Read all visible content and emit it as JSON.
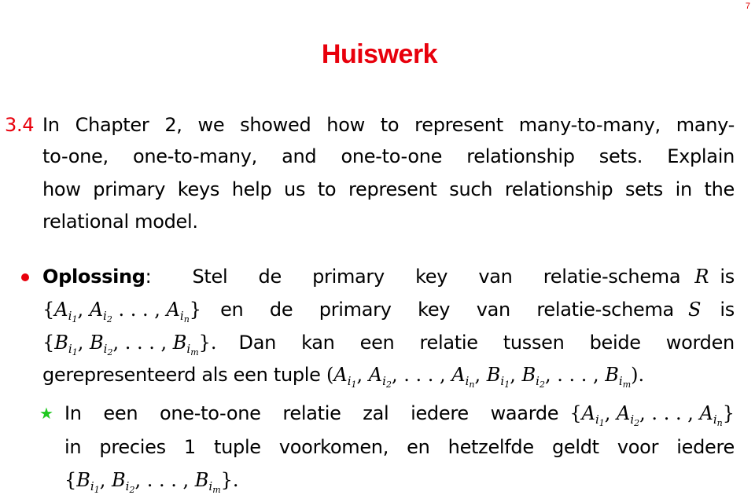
{
  "page_number": "7",
  "title": "Huiswerk",
  "exercise": {
    "number": "3.4",
    "lines": [
      "In Chapter 2, we showed how to represent many-to-many, many-",
      "to-one, one-to-many, and one-to-one relationship sets. Explain",
      "how primary keys help us to represent such relationship sets in the",
      "relational model."
    ]
  },
  "solution": {
    "bullet_icon": "red-bullet",
    "label": "Oplossing",
    "label_suffix": ":",
    "line1_text": "Stel de primary key van relatie-schema",
    "R": "R",
    "is": "is",
    "line2_text": "en de primary key van relatie-schema",
    "S": "S",
    "line3_text": "Dan kan een relatie tussen beide worden",
    "line4_text": "gerepresenteerd als een tuple"
  },
  "note": {
    "icon": "green-star",
    "line1_text": "In een one-to-one relatie zal iedere waarde",
    "line2": "in precies 1 tuple voorkomen, en hetzelfde geldt voor iedere"
  },
  "math": {
    "A_set": "{A_i1, A_i2 ..., A_in}",
    "B_set": "{B_i1, B_i2, ..., B_im}",
    "tuple": "(A_i1, A_i2, ..., A_in, B_i1, B_i2, ..., B_im)",
    "A_set_note": "{A_i1, A_i2, ..., A_in}"
  }
}
